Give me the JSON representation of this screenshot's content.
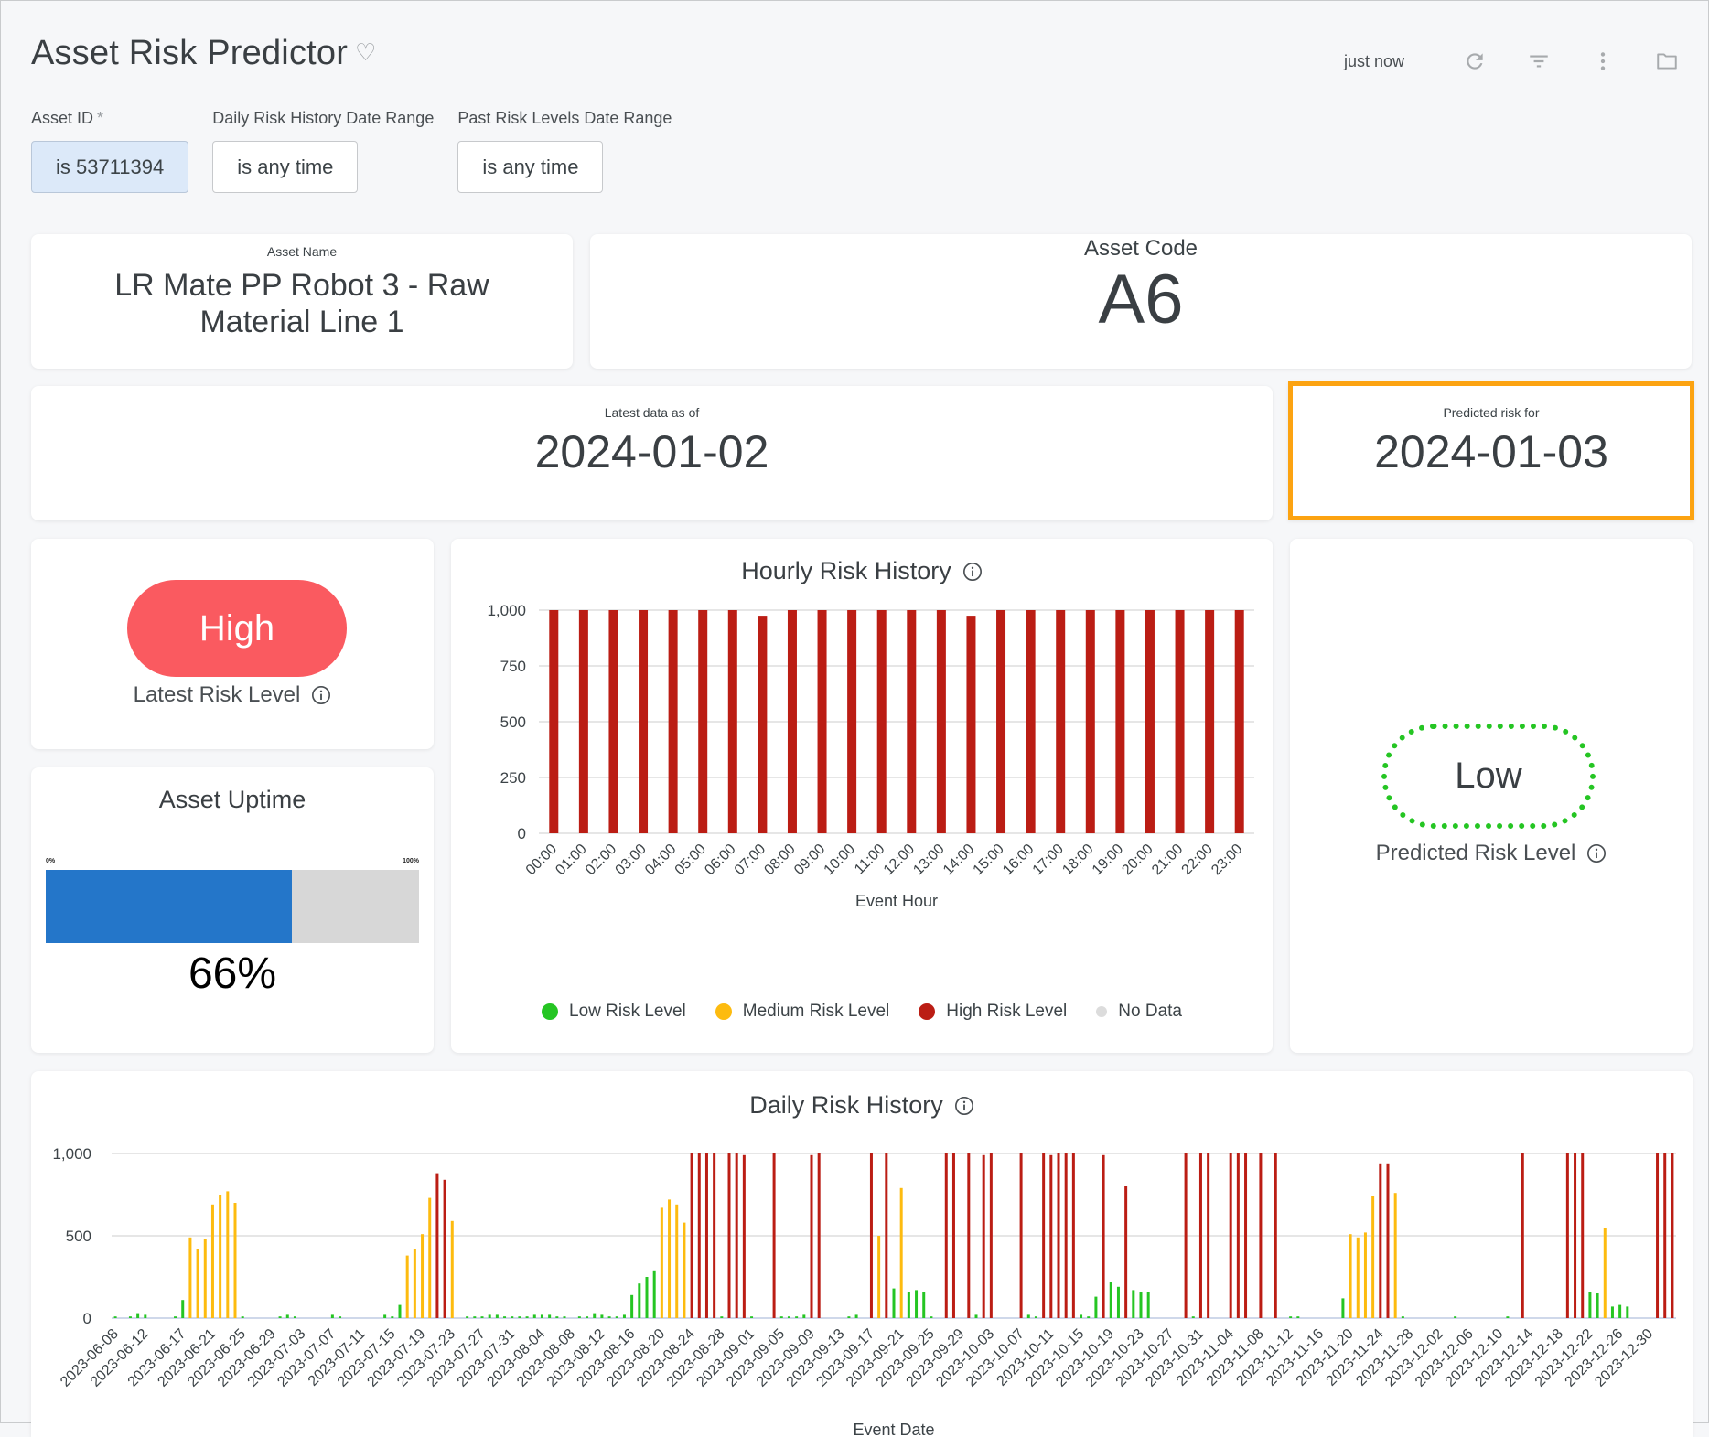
{
  "header": {
    "title": "Asset Risk Predictor",
    "last_refresh": "just now",
    "icons": [
      "heart-icon",
      "refresh-icon",
      "filter-icon",
      "more-vert-icon",
      "folder-icon"
    ]
  },
  "filters": [
    {
      "label": "Asset ID",
      "required": "*",
      "value": "is 53711394",
      "active": true
    },
    {
      "label": "Daily Risk History Date Range",
      "required": "",
      "value": "is any time",
      "active": false
    },
    {
      "label": "Past Risk Levels Date Range",
      "required": "",
      "value": "is any time",
      "active": false
    }
  ],
  "asset_name": {
    "label": "Asset Name",
    "value_line1": "LR Mate PP Robot 3 - Raw",
    "value_line2": "Material Line 1"
  },
  "asset_code": {
    "label": "Asset Code",
    "value": "A6"
  },
  "latest_data": {
    "label": "Latest data as of",
    "value": "2024-01-02"
  },
  "predicted_for": {
    "label": "Predicted risk for",
    "value": "2024-01-03",
    "highlight_color": "#fca311"
  },
  "latest_risk": {
    "value": "High",
    "caption": "Latest Risk Level",
    "color": "#fa5a60"
  },
  "uptime": {
    "title": "Asset Uptime",
    "min_label": "0%",
    "max_label": "100%",
    "percent": 66,
    "display": "66%",
    "fill_color": "#2476c9"
  },
  "predicted_risk": {
    "value": "Low",
    "caption": "Predicted Risk Level",
    "color": "#25c523"
  },
  "legend": [
    {
      "label": "Low Risk Level",
      "color": "#25c523"
    },
    {
      "label": "Medium Risk Level",
      "color": "#fdbb0f"
    },
    {
      "label": "High Risk Level",
      "color": "#bb1d14"
    },
    {
      "label": "No Data",
      "color": "#dcdcdc"
    }
  ],
  "chart_data": [
    {
      "type": "bar",
      "title": "Hourly Risk History",
      "xlabel": "Event Hour",
      "ylabel": "",
      "ylim": [
        0,
        1000
      ],
      "yticks": [
        "0",
        "250",
        "500",
        "750",
        "1,000"
      ],
      "grid": true,
      "legend_position": "bottom",
      "categories": [
        "00:00",
        "01:00",
        "02:00",
        "03:00",
        "04:00",
        "05:00",
        "06:00",
        "07:00",
        "08:00",
        "09:00",
        "10:00",
        "11:00",
        "12:00",
        "13:00",
        "14:00",
        "15:00",
        "16:00",
        "17:00",
        "18:00",
        "19:00",
        "20:00",
        "21:00",
        "22:00",
        "23:00"
      ],
      "values": [
        1000,
        1000,
        1000,
        1000,
        1000,
        1000,
        1000,
        975,
        1000,
        1000,
        1000,
        1000,
        1000,
        1000,
        975,
        1000,
        1000,
        1000,
        1000,
        1000,
        1000,
        1000,
        1000,
        1000
      ],
      "levels": [
        "high",
        "high",
        "high",
        "high",
        "high",
        "high",
        "high",
        "high",
        "high",
        "high",
        "high",
        "high",
        "high",
        "high",
        "high",
        "high",
        "high",
        "high",
        "high",
        "high",
        "high",
        "high",
        "high",
        "high"
      ]
    },
    {
      "type": "bar",
      "title": "Daily Risk History",
      "xlabel": "Event Date",
      "ylabel": "",
      "ylim": [
        0,
        1000
      ],
      "yticks": [
        "0",
        "500",
        "1,000"
      ],
      "grid": true,
      "tick_labels": [
        "2023-06-08",
        "2023-06-12",
        "2023-06-17",
        "2023-06-21",
        "2023-06-25",
        "2023-06-29",
        "2023-07-03",
        "2023-07-07",
        "2023-07-11",
        "2023-07-15",
        "2023-07-19",
        "2023-07-23",
        "2023-07-27",
        "2023-07-31",
        "2023-08-04",
        "2023-08-08",
        "2023-08-12",
        "2023-08-16",
        "2023-08-20",
        "2023-08-24",
        "2023-08-28",
        "2023-09-01",
        "2023-09-05",
        "2023-09-09",
        "2023-09-13",
        "2023-09-17",
        "2023-09-21",
        "2023-09-25",
        "2023-09-29",
        "2023-10-03",
        "2023-10-07",
        "2023-10-11",
        "2023-10-15",
        "2023-10-19",
        "2023-10-23",
        "2023-10-27",
        "2023-10-31",
        "2023-11-04",
        "2023-11-08",
        "2023-11-12",
        "2023-11-16",
        "2023-11-20",
        "2023-11-24",
        "2023-11-28",
        "2023-12-02",
        "2023-12-06",
        "2023-12-10",
        "2023-12-14",
        "2023-12-18",
        "2023-12-22",
        "2023-12-26",
        "2023-12-30"
      ],
      "points": [
        {
          "x": "2023-06-08",
          "v": 10,
          "l": "low"
        },
        {
          "x": "2023-06-10",
          "v": 10,
          "l": "low"
        },
        {
          "x": "2023-06-11",
          "v": 30,
          "l": "low"
        },
        {
          "x": "2023-06-12",
          "v": 20,
          "l": "low"
        },
        {
          "x": "2023-06-16",
          "v": 10,
          "l": "low"
        },
        {
          "x": "2023-06-17",
          "v": 110,
          "l": "low"
        },
        {
          "x": "2023-06-18",
          "v": 490,
          "l": "medium"
        },
        {
          "x": "2023-06-19",
          "v": 420,
          "l": "medium"
        },
        {
          "x": "2023-06-20",
          "v": 480,
          "l": "medium"
        },
        {
          "x": "2023-06-21",
          "v": 690,
          "l": "medium"
        },
        {
          "x": "2023-06-22",
          "v": 750,
          "l": "medium"
        },
        {
          "x": "2023-06-23",
          "v": 770,
          "l": "medium"
        },
        {
          "x": "2023-06-24",
          "v": 700,
          "l": "medium"
        },
        {
          "x": "2023-06-25",
          "v": 10,
          "l": "low"
        },
        {
          "x": "2023-06-30",
          "v": 10,
          "l": "low"
        },
        {
          "x": "2023-07-01",
          "v": 20,
          "l": "low"
        },
        {
          "x": "2023-07-02",
          "v": 10,
          "l": "low"
        },
        {
          "x": "2023-07-07",
          "v": 20,
          "l": "low"
        },
        {
          "x": "2023-07-08",
          "v": 10,
          "l": "low"
        },
        {
          "x": "2023-07-14",
          "v": 20,
          "l": "low"
        },
        {
          "x": "2023-07-15",
          "v": 10,
          "l": "low"
        },
        {
          "x": "2023-07-16",
          "v": 80,
          "l": "low"
        },
        {
          "x": "2023-07-17",
          "v": 380,
          "l": "medium"
        },
        {
          "x": "2023-07-18",
          "v": 420,
          "l": "medium"
        },
        {
          "x": "2023-07-19",
          "v": 510,
          "l": "medium"
        },
        {
          "x": "2023-07-20",
          "v": 730,
          "l": "medium"
        },
        {
          "x": "2023-07-21",
          "v": 880,
          "l": "high"
        },
        {
          "x": "2023-07-22",
          "v": 840,
          "l": "high"
        },
        {
          "x": "2023-07-23",
          "v": 590,
          "l": "medium"
        },
        {
          "x": "2023-07-25",
          "v": 10,
          "l": "low"
        },
        {
          "x": "2023-07-26",
          "v": 10,
          "l": "low"
        },
        {
          "x": "2023-07-27",
          "v": 10,
          "l": "low"
        },
        {
          "x": "2023-07-28",
          "v": 20,
          "l": "low"
        },
        {
          "x": "2023-07-29",
          "v": 20,
          "l": "low"
        },
        {
          "x": "2023-07-30",
          "v": 10,
          "l": "low"
        },
        {
          "x": "2023-07-31",
          "v": 10,
          "l": "low"
        },
        {
          "x": "2023-08-01",
          "v": 10,
          "l": "low"
        },
        {
          "x": "2023-08-02",
          "v": 10,
          "l": "low"
        },
        {
          "x": "2023-08-03",
          "v": 20,
          "l": "low"
        },
        {
          "x": "2023-08-04",
          "v": 20,
          "l": "low"
        },
        {
          "x": "2023-08-05",
          "v": 20,
          "l": "low"
        },
        {
          "x": "2023-08-06",
          "v": 10,
          "l": "low"
        },
        {
          "x": "2023-08-07",
          "v": 10,
          "l": "low"
        },
        {
          "x": "2023-08-09",
          "v": 10,
          "l": "low"
        },
        {
          "x": "2023-08-10",
          "v": 10,
          "l": "low"
        },
        {
          "x": "2023-08-11",
          "v": 30,
          "l": "low"
        },
        {
          "x": "2023-08-12",
          "v": 20,
          "l": "low"
        },
        {
          "x": "2023-08-13",
          "v": 10,
          "l": "low"
        },
        {
          "x": "2023-08-14",
          "v": 10,
          "l": "low"
        },
        {
          "x": "2023-08-15",
          "v": 20,
          "l": "low"
        },
        {
          "x": "2023-08-16",
          "v": 140,
          "l": "low"
        },
        {
          "x": "2023-08-17",
          "v": 210,
          "l": "low"
        },
        {
          "x": "2023-08-18",
          "v": 250,
          "l": "low"
        },
        {
          "x": "2023-08-19",
          "v": 290,
          "l": "low"
        },
        {
          "x": "2023-08-20",
          "v": 670,
          "l": "medium"
        },
        {
          "x": "2023-08-21",
          "v": 720,
          "l": "medium"
        },
        {
          "x": "2023-08-22",
          "v": 690,
          "l": "medium"
        },
        {
          "x": "2023-08-23",
          "v": 580,
          "l": "medium"
        },
        {
          "x": "2023-08-24",
          "v": 1000,
          "l": "high"
        },
        {
          "x": "2023-08-25",
          "v": 1000,
          "l": "high"
        },
        {
          "x": "2023-08-26",
          "v": 1000,
          "l": "high"
        },
        {
          "x": "2023-08-27",
          "v": 1000,
          "l": "high"
        },
        {
          "x": "2023-08-28",
          "v": 10,
          "l": "low"
        },
        {
          "x": "2023-08-29",
          "v": 1000,
          "l": "high"
        },
        {
          "x": "2023-08-30",
          "v": 1000,
          "l": "high"
        },
        {
          "x": "2023-08-31",
          "v": 990,
          "l": "high"
        },
        {
          "x": "2023-09-01",
          "v": 10,
          "l": "low"
        },
        {
          "x": "2023-09-04",
          "v": 1000,
          "l": "high"
        },
        {
          "x": "2023-09-05",
          "v": 10,
          "l": "low"
        },
        {
          "x": "2023-09-06",
          "v": 10,
          "l": "low"
        },
        {
          "x": "2023-09-07",
          "v": 10,
          "l": "low"
        },
        {
          "x": "2023-09-08",
          "v": 20,
          "l": "low"
        },
        {
          "x": "2023-09-09",
          "v": 990,
          "l": "high"
        },
        {
          "x": "2023-09-10",
          "v": 1000,
          "l": "high"
        },
        {
          "x": "2023-09-14",
          "v": 10,
          "l": "low"
        },
        {
          "x": "2023-09-15",
          "v": 20,
          "l": "low"
        },
        {
          "x": "2023-09-17",
          "v": 1000,
          "l": "high"
        },
        {
          "x": "2023-09-18",
          "v": 500,
          "l": "medium"
        },
        {
          "x": "2023-09-19",
          "v": 1000,
          "l": "high"
        },
        {
          "x": "2023-09-20",
          "v": 180,
          "l": "low"
        },
        {
          "x": "2023-09-21",
          "v": 790,
          "l": "medium"
        },
        {
          "x": "2023-09-22",
          "v": 160,
          "l": "low"
        },
        {
          "x": "2023-09-23",
          "v": 170,
          "l": "low"
        },
        {
          "x": "2023-09-24",
          "v": 160,
          "l": "low"
        },
        {
          "x": "2023-09-25",
          "v": 10,
          "l": "low"
        },
        {
          "x": "2023-09-27",
          "v": 1000,
          "l": "high"
        },
        {
          "x": "2023-09-28",
          "v": 1000,
          "l": "high"
        },
        {
          "x": "2023-09-30",
          "v": 1000,
          "l": "high"
        },
        {
          "x": "2023-10-01",
          "v": 20,
          "l": "low"
        },
        {
          "x": "2023-10-02",
          "v": 990,
          "l": "high"
        },
        {
          "x": "2023-10-03",
          "v": 1000,
          "l": "high"
        },
        {
          "x": "2023-10-07",
          "v": 1000,
          "l": "high"
        },
        {
          "x": "2023-10-08",
          "v": 20,
          "l": "low"
        },
        {
          "x": "2023-10-09",
          "v": 10,
          "l": "low"
        },
        {
          "x": "2023-10-10",
          "v": 1000,
          "l": "high"
        },
        {
          "x": "2023-10-11",
          "v": 990,
          "l": "high"
        },
        {
          "x": "2023-10-12",
          "v": 1000,
          "l": "high"
        },
        {
          "x": "2023-10-13",
          "v": 1000,
          "l": "high"
        },
        {
          "x": "2023-10-14",
          "v": 1000,
          "l": "high"
        },
        {
          "x": "2023-10-15",
          "v": 20,
          "l": "low"
        },
        {
          "x": "2023-10-16",
          "v": 10,
          "l": "low"
        },
        {
          "x": "2023-10-17",
          "v": 130,
          "l": "low"
        },
        {
          "x": "2023-10-18",
          "v": 990,
          "l": "high"
        },
        {
          "x": "2023-10-19",
          "v": 220,
          "l": "low"
        },
        {
          "x": "2023-10-20",
          "v": 190,
          "l": "low"
        },
        {
          "x": "2023-10-21",
          "v": 800,
          "l": "high"
        },
        {
          "x": "2023-10-22",
          "v": 170,
          "l": "low"
        },
        {
          "x": "2023-10-23",
          "v": 160,
          "l": "low"
        },
        {
          "x": "2023-10-24",
          "v": 160,
          "l": "low"
        },
        {
          "x": "2023-10-29",
          "v": 1000,
          "l": "high"
        },
        {
          "x": "2023-10-30",
          "v": 10,
          "l": "low"
        },
        {
          "x": "2023-10-31",
          "v": 1000,
          "l": "high"
        },
        {
          "x": "2023-11-01",
          "v": 1000,
          "l": "high"
        },
        {
          "x": "2023-11-04",
          "v": 1000,
          "l": "high"
        },
        {
          "x": "2023-11-05",
          "v": 1000,
          "l": "high"
        },
        {
          "x": "2023-11-06",
          "v": 1000,
          "l": "high"
        },
        {
          "x": "2023-11-08",
          "v": 1000,
          "l": "high"
        },
        {
          "x": "2023-11-10",
          "v": 1000,
          "l": "high"
        },
        {
          "x": "2023-11-12",
          "v": 10,
          "l": "low"
        },
        {
          "x": "2023-11-13",
          "v": 10,
          "l": "low"
        },
        {
          "x": "2023-11-19",
          "v": 120,
          "l": "low"
        },
        {
          "x": "2023-11-20",
          "v": 510,
          "l": "medium"
        },
        {
          "x": "2023-11-21",
          "v": 490,
          "l": "medium"
        },
        {
          "x": "2023-11-22",
          "v": 520,
          "l": "medium"
        },
        {
          "x": "2023-11-23",
          "v": 740,
          "l": "medium"
        },
        {
          "x": "2023-11-24",
          "v": 940,
          "l": "high"
        },
        {
          "x": "2023-11-25",
          "v": 940,
          "l": "high"
        },
        {
          "x": "2023-11-26",
          "v": 760,
          "l": "medium"
        },
        {
          "x": "2023-11-27",
          "v": 10,
          "l": "low"
        },
        {
          "x": "2023-12-04",
          "v": 10,
          "l": "low"
        },
        {
          "x": "2023-12-11",
          "v": 10,
          "l": "low"
        },
        {
          "x": "2023-12-13",
          "v": 1000,
          "l": "high"
        },
        {
          "x": "2023-12-19",
          "v": 1000,
          "l": "high"
        },
        {
          "x": "2023-12-20",
          "v": 1000,
          "l": "high"
        },
        {
          "x": "2023-12-21",
          "v": 1000,
          "l": "high"
        },
        {
          "x": "2023-12-22",
          "v": 160,
          "l": "low"
        },
        {
          "x": "2023-12-23",
          "v": 150,
          "l": "low"
        },
        {
          "x": "2023-12-24",
          "v": 550,
          "l": "medium"
        },
        {
          "x": "2023-12-25",
          "v": 70,
          "l": "low"
        },
        {
          "x": "2023-12-26",
          "v": 80,
          "l": "low"
        },
        {
          "x": "2023-12-27",
          "v": 70,
          "l": "low"
        },
        {
          "x": "2023-12-31",
          "v": 1000,
          "l": "high"
        },
        {
          "x": "2024-01-01",
          "v": 1000,
          "l": "high"
        },
        {
          "x": "2024-01-02",
          "v": 1000,
          "l": "high"
        }
      ],
      "x_range": [
        "2023-06-08",
        "2024-01-02"
      ]
    }
  ]
}
